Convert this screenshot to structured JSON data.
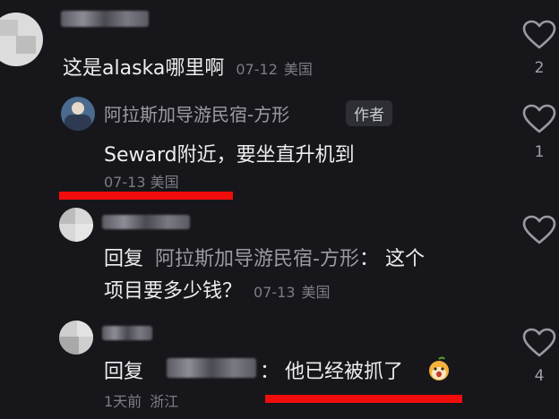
{
  "comments": [
    {
      "text": "这是alaska哪里啊",
      "date": "07-12",
      "location": "美国",
      "likes": "2"
    }
  ],
  "author_reply": {
    "user": "阿拉斯加导游民宿-方形",
    "badge": "作者",
    "text": "Seward附近，要坐直升机到",
    "date": "07-13",
    "location": "美国",
    "likes": "1"
  },
  "reply_2": {
    "prefix": "回复",
    "reply_to": "阿拉斯加导游民宿-方形",
    "colon": "：",
    "text_line1": "这个",
    "text_line2": "项目要多少钱？",
    "date": "07-13",
    "location": "美国"
  },
  "reply_3": {
    "prefix": "回复",
    "colon": "：",
    "text": "他已经被抓了",
    "time": "1天前",
    "location": "浙江",
    "likes": "4"
  },
  "colors": {
    "background": "#17171b",
    "highlight_bar": "#f20d0d",
    "muted_text": "#7c7c86"
  }
}
